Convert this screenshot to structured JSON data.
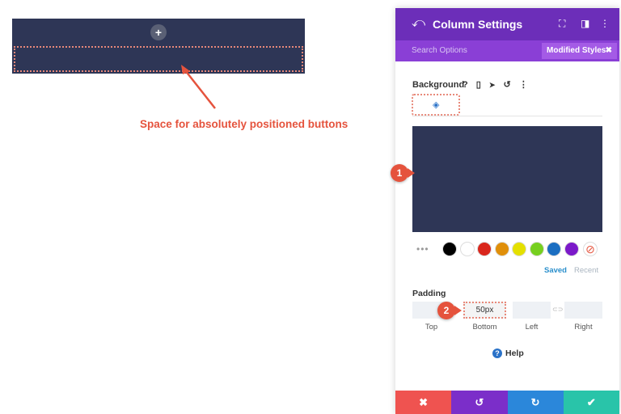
{
  "canvas": {
    "plus_glyph": "+",
    "annotation": "Space for absolutely positioned buttons",
    "row_color": "#2e3656",
    "annotation_color": "#e5533d"
  },
  "panel": {
    "back_icon": "undo-arrow-icon",
    "back_glyph": "⤺",
    "title": "Column Settings",
    "header_icons": [
      {
        "name": "expand-icon",
        "glyph": "⛶"
      },
      {
        "name": "columns-layout-icon",
        "glyph": "◨"
      },
      {
        "name": "more-options-icon",
        "glyph": "⋮"
      }
    ],
    "search_placeholder": "Search Options",
    "modified_styles": "Modified Styles",
    "modified_close": "✖",
    "accent_color": "#6c2eb9"
  },
  "background": {
    "label": "Background",
    "label_icons": [
      {
        "name": "help-question-icon",
        "glyph": "?"
      },
      {
        "name": "mobile-device-icon",
        "glyph": "▯"
      },
      {
        "name": "hover-pointer-icon",
        "glyph": "➤"
      },
      {
        "name": "reset-icon",
        "glyph": "↺"
      },
      {
        "name": "more-vertical-icon",
        "glyph": "⋮"
      }
    ],
    "tab_icon": "paint-bucket-icon",
    "tab_glyph": "◈",
    "preview_color": "#2e3656",
    "marker_1": "1",
    "swatch_more": "•••",
    "swatches": [
      "#000000",
      "#ffffff",
      "#d9261c",
      "#e08f0a",
      "#e4e000",
      "#76cf1f",
      "#1b6ec1",
      "#7b19c9"
    ],
    "no_color_glyph": "⊘",
    "saved": "Saved",
    "recent": "Recent"
  },
  "padding": {
    "label": "Padding",
    "marker_2": "2",
    "fields": [
      {
        "label": "Top",
        "value": ""
      },
      {
        "label": "Bottom",
        "value": "50px"
      },
      {
        "label": "Left",
        "value": ""
      },
      {
        "label": "Right",
        "value": ""
      }
    ],
    "link_glyph": "⊂⊃"
  },
  "help": {
    "icon_glyph": "?",
    "label": "Help"
  },
  "footer": {
    "buttons": [
      {
        "name": "cancel-button",
        "glyph": "✖",
        "color": "#ef5350"
      },
      {
        "name": "undo-button",
        "glyph": "↺",
        "color": "#7b2ec9"
      },
      {
        "name": "redo-button",
        "glyph": "↻",
        "color": "#2b87da"
      },
      {
        "name": "save-button",
        "glyph": "✔",
        "color": "#29c4a9"
      }
    ]
  }
}
